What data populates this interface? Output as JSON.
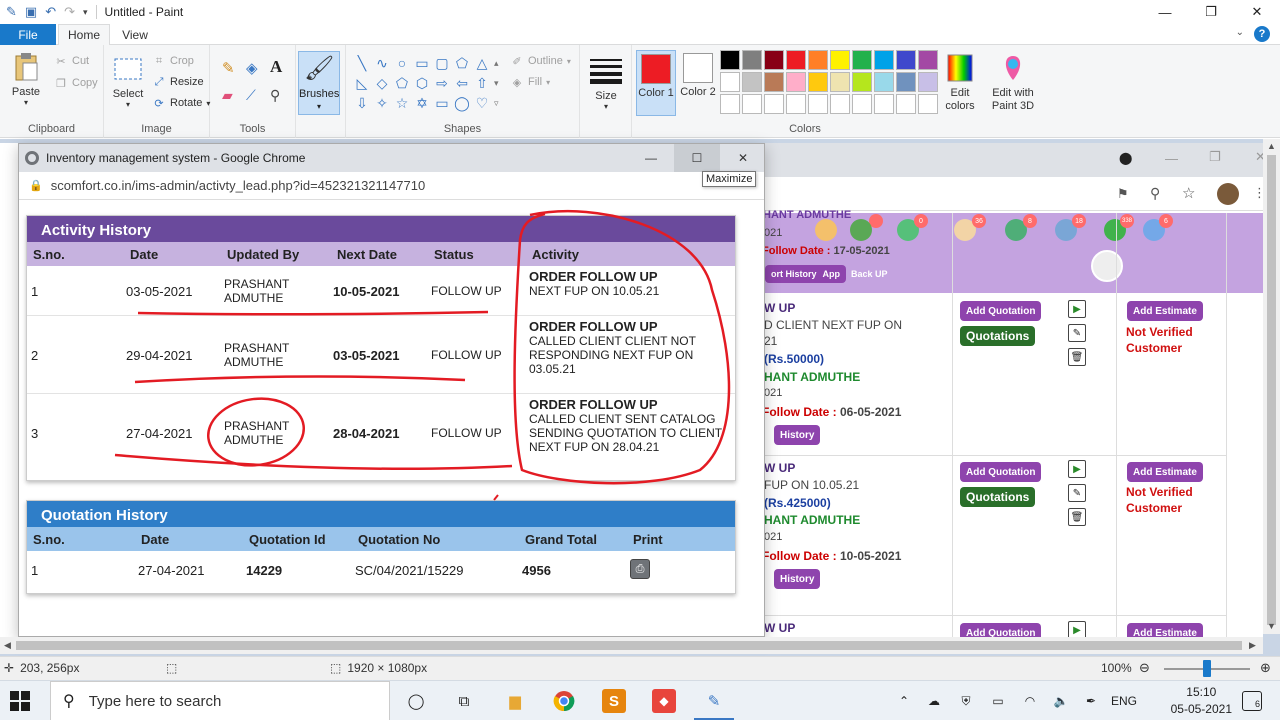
{
  "paint": {
    "title": "Untitled - Paint",
    "tabs": {
      "file": "File",
      "home": "Home",
      "view": "View"
    },
    "clipboard": {
      "paste": "Paste",
      "cut": "Cut",
      "copy": "Copy",
      "label": "Clipboard"
    },
    "image": {
      "select": "Select",
      "crop": "Crop",
      "resize": "Resize",
      "rotate": "Rotate",
      "label": "Image"
    },
    "tools": {
      "label": "Tools"
    },
    "brushes": {
      "label": "Brushes"
    },
    "shapes": {
      "outline": "Outline",
      "fill": "Fill",
      "label": "Shapes"
    },
    "size": {
      "label": "Size"
    },
    "colors": {
      "color1_label": "Color 1",
      "color2_label": "Color 2",
      "edit_colors": "Edit colors",
      "edit_with_3d": "Edit with Paint 3D",
      "label": "Colors",
      "color1": "#ed1c24",
      "color2": "#ffffff",
      "palette": [
        "#000000",
        "#7f7f7f",
        "#880015",
        "#ed1c24",
        "#ff7f27",
        "#fff200",
        "#22b14c",
        "#00a2e8",
        "#3f48cc",
        "#a349a4",
        "#ffffff",
        "#c3c3c3",
        "#b97a57",
        "#ffaec9",
        "#ffc90e",
        "#efe4b0",
        "#b5e61d",
        "#99d9ea",
        "#7092be",
        "#c8bfe7",
        "#ffffff",
        "#ffffff",
        "#ffffff",
        "#ffffff",
        "#ffffff",
        "#ffffff",
        "#ffffff",
        "#ffffff",
        "#ffffff",
        "#ffffff"
      ]
    },
    "status": {
      "cursor_pos": "203, 256px",
      "image_size": "1920 × 1080px",
      "zoom": "100%"
    }
  },
  "popup": {
    "title": "Inventory management system - Google Chrome",
    "url": "scomfort.co.in/ims-admin/activty_lead.php?id=452321321147710",
    "tooltip": "Maximize",
    "activity": {
      "heading": "Activity History",
      "columns": [
        "S.no.",
        "Date",
        "Updated By",
        "Next Date",
        "Status",
        "Activity"
      ],
      "rows": [
        {
          "sno": "1",
          "date": "03-05-2021",
          "by_line1": "PRASHANT",
          "by_line2": "ADMUTHE",
          "next": "10-05-2021",
          "status": "FOLLOW UP",
          "act_title": "ORDER FOLLOW UP",
          "act_body": "NEXT FUP ON 10.05.21"
        },
        {
          "sno": "2",
          "date": "29-04-2021",
          "by_line1": "PRASHANT",
          "by_line2": "ADMUTHE",
          "next": "03-05-2021",
          "status": "FOLLOW UP",
          "act_title": "ORDER FOLLOW UP",
          "act_body": "CALLED CLIENT CLIENT NOT RESPONDING NEXT FUP ON 03.05.21"
        },
        {
          "sno": "3",
          "date": "27-04-2021",
          "by_line1": "PRASHANT",
          "by_line2": "ADMUTHE",
          "next": "28-04-2021",
          "status": "FOLLOW UP",
          "act_title": "ORDER FOLLOW UP",
          "act_body": "CALLED CLIENT SENT CATALOG SENDING QUOTATION TO CLIENT NEXT FUP ON 28.04.21"
        }
      ]
    },
    "quotation": {
      "heading": "Quotation History",
      "columns": [
        "S.no.",
        "Date",
        "Quotation Id",
        "Quotation No",
        "Grand Total",
        "Print"
      ],
      "rows": [
        {
          "sno": "1",
          "date": "27-04-2021",
          "qid": "14229",
          "qno": "SC/04/2021/15229",
          "total": "4956"
        }
      ]
    }
  },
  "background": {
    "header_name": "HANT ADMUTHE",
    "header_year": "021",
    "fd_label_1": "Follow Date : ",
    "fd_value_1": "17-05-2021",
    "history_tab": "ort History",
    "app_tab": "App",
    "back_up": "Back UP",
    "add_quotation": "Add Quotation",
    "quotations": "Quotations",
    "add_estimate": "Add Estimate",
    "not_verified": "Not Verified Customer",
    "history": "History",
    "row1": {
      "l1": "W UP",
      "l2": "D CLIENT NEXT FUP ON",
      "l3": "21",
      "amount": "(Rs.50000)",
      "name": "HANT ADMUTHE",
      "year": "021",
      "fd": "Follow Date : ",
      "fdv": "06-05-2021"
    },
    "row2": {
      "l1": "W UP",
      "l2": "FUP ON 10.05.21",
      "amount": "(Rs.425000)",
      "name": "HANT ADMUTHE",
      "year": "021",
      "fd": "Follow Date : ",
      "fdv": "10-05-2021"
    },
    "row3": {
      "l1": "W UP"
    },
    "badges": [
      "0",
      "36",
      "8",
      "18",
      "338",
      "6"
    ]
  },
  "taskbar": {
    "search_placeholder": "Type here to search",
    "lang": "ENG",
    "time": "15:10",
    "date": "05-05-2021",
    "notifications": "6"
  }
}
